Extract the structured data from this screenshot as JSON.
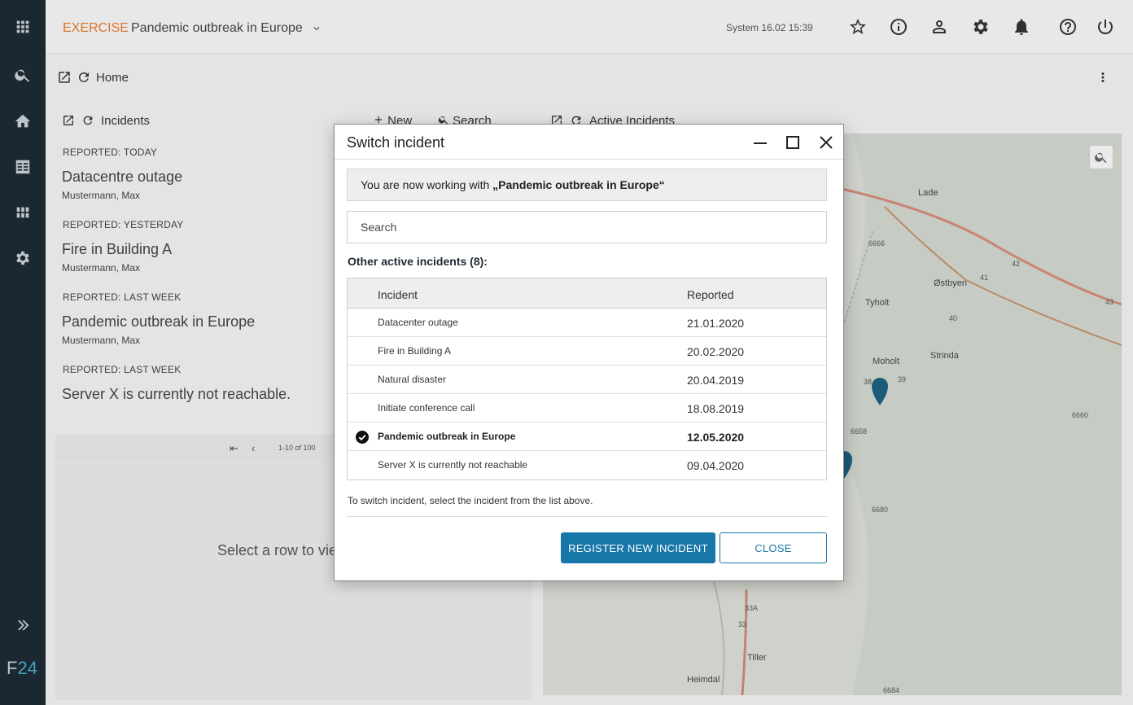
{
  "rail": {
    "icons": [
      "apps-grid-icon",
      "search-icon",
      "home-icon",
      "dashboard-icon",
      "modules-icon",
      "gear-icon",
      "expand-icon"
    ],
    "logo_f": "F",
    "logo_num": "24"
  },
  "topbar": {
    "mode": "EXERCISE",
    "incident_title": "Pandemic outbreak in Europe",
    "system_time": "System 16.02 15:39",
    "icons": [
      "star-icon",
      "info-icon",
      "user-icon",
      "gear-icon",
      "bell-icon",
      "help-icon",
      "power-icon"
    ]
  },
  "home": {
    "label": "Home"
  },
  "incidents_panel": {
    "title": "Incidents",
    "new_label": "New",
    "search_label": "Search",
    "items": [
      {
        "section": "REPORTED: TODAY",
        "name": "Datacentre outage",
        "reporter": "Mustermann, Max"
      },
      {
        "section": "REPORTED: YESTERDAY",
        "name": "Fire in Building A",
        "reporter": "Mustermann, Max"
      },
      {
        "section": "REPORTED: LAST WEEK",
        "name": "Pandemic outbreak in Europe",
        "reporter": "Mustermann, Max"
      },
      {
        "section": "REPORTED: LAST WEEK",
        "name": "Server X is currently not reachable.",
        "reporter": ""
      }
    ],
    "pager_text": "1-10 of 100"
  },
  "detail_panel": {
    "placeholder": "Select a row to view details"
  },
  "map_panel": {
    "title": "Active Incidents",
    "labels": [
      "Lade",
      "Østbyen",
      "Tyholt",
      "Moholt",
      "Strinda",
      "Tiller",
      "Heimdal"
    ],
    "road_numbers": [
      "6666",
      "42",
      "41",
      "40",
      "43",
      "39",
      "38",
      "6658",
      "6660",
      "6680",
      "6684",
      "33",
      "33A"
    ]
  },
  "dialog": {
    "title": "Switch incident",
    "notice_prefix": "You are now working with ",
    "notice_incident": "„Pandemic outbreak in Europe“",
    "search_placeholder": "Search",
    "other_label": "Other active incidents (8):",
    "col_incident": "Incident",
    "col_reported": "Reported",
    "rows": [
      {
        "name": "Datacenter outage",
        "reported": "21.01.2020",
        "selected": false
      },
      {
        "name": "Fire in Building A",
        "reported": "20.02.2020",
        "selected": false
      },
      {
        "name": "Natural disaster",
        "reported": "20.04.2019",
        "selected": false
      },
      {
        "name": "Initiate conference call",
        "reported": "18.08.2019",
        "selected": false
      },
      {
        "name": "Pandemic outbreak in Europe",
        "reported": "12.05.2020",
        "selected": true
      },
      {
        "name": "Server X is currently not reachable",
        "reported": "09.04.2020",
        "selected": false
      }
    ],
    "hint": "To switch incident, select the incident from the list above.",
    "register_button": "REGISTER NEW INCIDENT",
    "close_button": "CLOSE"
  },
  "colors": {
    "rail_bg": "#1e2a33",
    "accent_orange": "#e3792e",
    "primary_blue": "#1777a8",
    "logo_blue": "#4aa6c9"
  }
}
